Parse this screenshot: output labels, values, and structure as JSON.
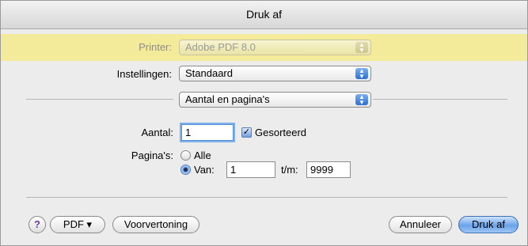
{
  "window": {
    "title": "Druk af"
  },
  "printer": {
    "label": "Printer:",
    "value": "Adobe PDF 8.0"
  },
  "presets": {
    "label": "Instellingen:",
    "value": "Standaard"
  },
  "panel": {
    "value": "Aantal en pagina's"
  },
  "copies": {
    "label": "Aantal:",
    "value": "1",
    "collated_label": "Gesorteerd",
    "collated_checked": true
  },
  "pages": {
    "label": "Pagina's:",
    "all_label": "Alle",
    "from_label": "Van:",
    "from_value": "1",
    "to_label": "t/m:",
    "to_value": "9999",
    "selected": "from"
  },
  "footer": {
    "help_label": "?",
    "pdf_label": "PDF ▾",
    "preview_label": "Voorvertoning",
    "cancel_label": "Annuleer",
    "print_label": "Druk af"
  },
  "icons": {
    "popup_arrows": "up-down-arrows-icon",
    "check": "checkmark-icon",
    "help": "question-mark-icon"
  }
}
